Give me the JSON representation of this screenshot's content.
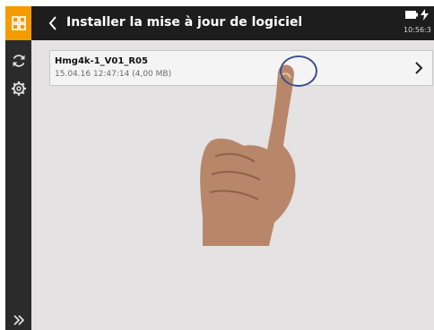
{
  "header": {
    "title": "Installer la mise à jour de logiciel",
    "time": "10:56:3"
  },
  "file": {
    "name": "Hmg4k-1_V01_R05",
    "meta": "15.04.16  12:47:14  (4,00 MB)"
  },
  "icons": {
    "home": "grid-icon",
    "back": "chevron-left-icon",
    "sync": "refresh-icon",
    "settings": "gear-icon",
    "expand": "double-chevron-right-icon",
    "open": "chevron-right-icon",
    "battery": "battery-icon",
    "charging": "bolt-icon"
  },
  "colors": {
    "accent": "#f39c00",
    "topbar": "#1d1d1d",
    "sidebar": "#2b2b2b",
    "content_bg": "#e4e2e3",
    "touch_circle": "#3d4f8c"
  }
}
